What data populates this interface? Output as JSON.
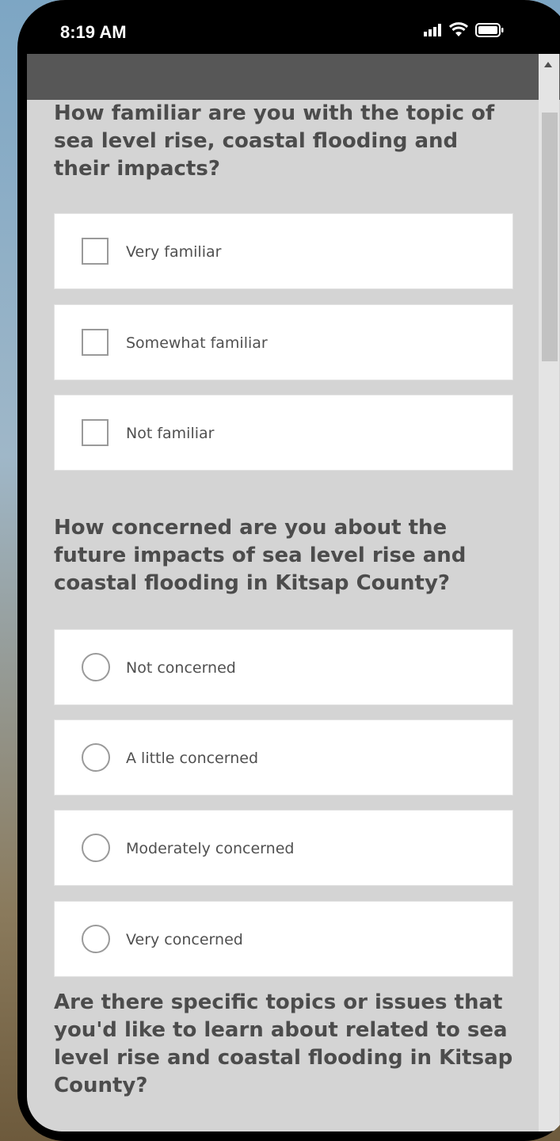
{
  "status_bar": {
    "time": "8:19 AM",
    "icons": [
      "signal-icon",
      "wifi-icon",
      "battery-icon"
    ]
  },
  "colors": {
    "page_background": "#d4d4d4",
    "header_bar": "#575757",
    "question_text": "#4c4c4c",
    "option_background": "#ffffff",
    "control_border": "#9a9a9a"
  },
  "survey": {
    "questions": [
      {
        "text": "How familiar are you with the topic of sea level rise, coastal flooding and their impacts?",
        "control": "checkbox",
        "options": [
          {
            "label": "Very familiar",
            "checked": false
          },
          {
            "label": "Somewhat familiar",
            "checked": false
          },
          {
            "label": "Not familiar",
            "checked": false
          }
        ]
      },
      {
        "text": "How concerned are you about the future impacts of sea level rise and coastal flooding in Kitsap County?",
        "control": "radio",
        "options": [
          {
            "label": "Not concerned",
            "checked": false
          },
          {
            "label": "A little concerned",
            "checked": false
          },
          {
            "label": "Moderately concerned",
            "checked": false
          },
          {
            "label": "Very concerned",
            "checked": false
          }
        ]
      },
      {
        "text": "Are there specific topics or issues that you'd like to learn about related to sea level rise and coastal flooding in Kitsap County?"
      }
    ]
  }
}
